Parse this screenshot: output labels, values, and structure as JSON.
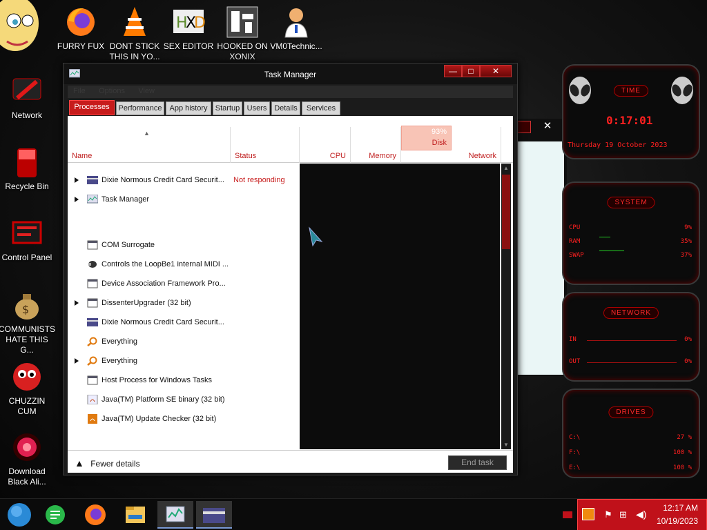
{
  "desktop": {
    "icons": [
      {
        "label": "FURRY FUX"
      },
      {
        "label": "DONT STICK THIS IN YO..."
      },
      {
        "label": "SEX EDITOR"
      },
      {
        "label": "HOOKED ON XONIX"
      },
      {
        "label": "VM0Technic..."
      },
      {
        "label": "Network"
      },
      {
        "label": "Recycle Bin"
      },
      {
        "label": "Control Panel"
      },
      {
        "label": "COMMUNISTS HATE THIS G..."
      },
      {
        "label": "CHUZZIN CUM"
      },
      {
        "label": "Download Black Ali..."
      }
    ]
  },
  "task_manager": {
    "title": "Task Manager",
    "menu": [
      "File",
      "Options",
      "View"
    ],
    "tabs": [
      "Processes",
      "Performance",
      "App history",
      "Startup",
      "Users",
      "Details",
      "Services"
    ],
    "columns": {
      "name": "Name",
      "status": "Status",
      "cpu": "CPU",
      "memory": "Memory",
      "disk": "Disk",
      "disk_pct": "93%",
      "network": "Network"
    },
    "rows": [
      {
        "name": "Dixie Normous Credit Card Securit...",
        "status": "Not responding"
      },
      {
        "name": "Task Manager",
        "status": ""
      },
      {
        "name": "COM Surrogate",
        "status": ""
      },
      {
        "name": "Controls the LoopBe1 internal MIDI ...",
        "status": ""
      },
      {
        "name": "Device Association Framework Pro...",
        "status": ""
      },
      {
        "name": "DissenterUpgrader (32 bit)",
        "status": ""
      },
      {
        "name": "Dixie Normous Credit Card Securit...",
        "status": ""
      },
      {
        "name": "Everything",
        "status": ""
      },
      {
        "name": "Everything",
        "status": ""
      },
      {
        "name": "Host Process for Windows Tasks",
        "status": ""
      },
      {
        "name": "Java(TM) Platform SE binary (32 bit)",
        "status": ""
      },
      {
        "name": "Java(TM) Update Checker (32 bit)",
        "status": ""
      }
    ],
    "fewer_details": "Fewer details",
    "end_task": "End task",
    "minimize": "—",
    "maximize": "□",
    "close": "✕"
  },
  "background_window": {
    "close": "✕"
  },
  "gadget": {
    "time_title": "TIME",
    "time": "0:17:01",
    "date": "Thursday 19 October 2023",
    "system_title": "SYSTEM",
    "cpu_label": "CPU",
    "cpu_value": "9%",
    "ram_label": "RAM",
    "ram_value": "35%",
    "swap_label": "SWAP",
    "swap_value": "37%",
    "network_title": "NETWORK",
    "in_label": "IN",
    "in_value": "0%",
    "out_label": "OUT",
    "out_value": "0%",
    "drives_title": "DRIVES",
    "drives": [
      {
        "label": "C:\\",
        "value": "27 %"
      },
      {
        "label": "F:\\",
        "value": "100 %"
      },
      {
        "label": "E:\\",
        "value": "100 %"
      }
    ]
  },
  "taskbar": {
    "time": "12:17 AM",
    "date": "10/19/2023"
  }
}
